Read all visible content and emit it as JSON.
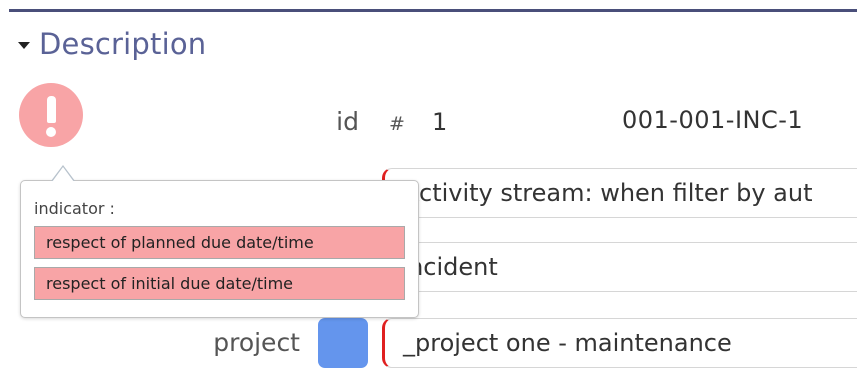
{
  "section": {
    "title": "Description"
  },
  "indicator": {
    "icon": "exclamation-circle-icon",
    "color": "#f8a4a6",
    "tooltip": {
      "label": "indicator :",
      "items": [
        "respect of planned due date/time",
        "respect of initial due date/time"
      ]
    }
  },
  "fields": {
    "id": {
      "label": "id",
      "icon": "hash-icon",
      "icon_glyph": "#",
      "value": "1",
      "reference": "001-001-INC-1"
    },
    "title": {
      "value": "Activity stream: when filter by aut"
    },
    "type": {
      "value": "Incident"
    },
    "project": {
      "label": "project",
      "color": "#6495ed",
      "value": "_project one - maintenance"
    }
  },
  "colors": {
    "header_rule": "#4a4f7a",
    "section_title": "#5a6296",
    "required_marker": "#e02020"
  }
}
